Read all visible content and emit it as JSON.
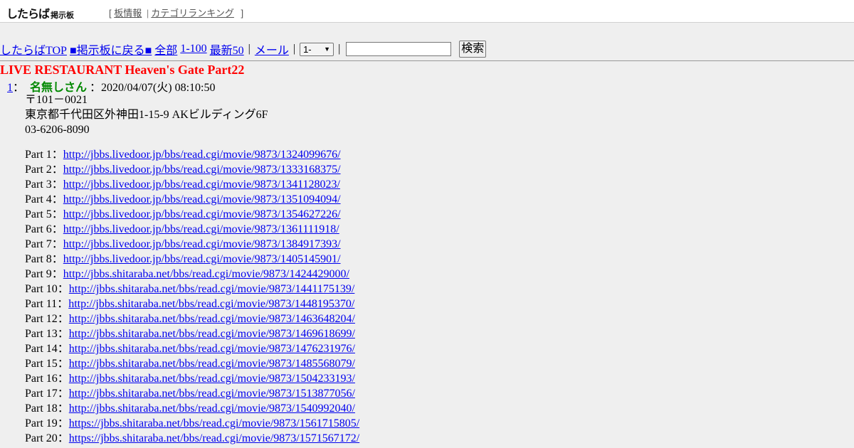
{
  "header": {
    "logo_main": "したらば",
    "logo_sub": "掲示板",
    "bracket_open": "[",
    "bracket_close": "]",
    "links": [
      "板情報",
      "カテゴリランキング"
    ]
  },
  "nav": {
    "top": "したらばTOP",
    "back": "■掲示板に戻る■",
    "all": "全部",
    "range": "1-100",
    "latest": "最新50",
    "mail": "メール",
    "select_value": "1-",
    "search_button": "検索",
    "search_value": ""
  },
  "thread_title": "LIVE RESTAURANT Heaven's Gate Part22",
  "post": {
    "number": "1",
    "colon": "：",
    "name": "名無しさん",
    "date": "：2020/04/07(火) 08:10:50",
    "address_lines": [
      "〒101－0021",
      "東京都千代田区外神田1-15-9 AKビルディング6F",
      "03-6206-8090"
    ],
    "parts": [
      {
        "label": "Part 1：",
        "url": "http://jbbs.livedoor.jp/bbs/read.cgi/movie/9873/1324099676/"
      },
      {
        "label": "Part 2：",
        "url": "http://jbbs.livedoor.jp/bbs/read.cgi/movie/9873/1333168375/"
      },
      {
        "label": "Part 3：",
        "url": "http://jbbs.livedoor.jp/bbs/read.cgi/movie/9873/1341128023/"
      },
      {
        "label": "Part 4：",
        "url": "http://jbbs.livedoor.jp/bbs/read.cgi/movie/9873/1351094094/"
      },
      {
        "label": "Part 5：",
        "url": "http://jbbs.livedoor.jp/bbs/read.cgi/movie/9873/1354627226/"
      },
      {
        "label": "Part 6：",
        "url": "http://jbbs.livedoor.jp/bbs/read.cgi/movie/9873/1361111918/"
      },
      {
        "label": "Part 7：",
        "url": "http://jbbs.livedoor.jp/bbs/read.cgi/movie/9873/1384917393/"
      },
      {
        "label": "Part 8：",
        "url": "http://jbbs.livedoor.jp/bbs/read.cgi/movie/9873/1405145901/"
      },
      {
        "label": "Part 9：",
        "url": "http://jbbs.shitaraba.net/bbs/read.cgi/movie/9873/1424429000/"
      },
      {
        "label": "Part 10：",
        "url": "http://jbbs.shitaraba.net/bbs/read.cgi/movie/9873/1441175139/"
      },
      {
        "label": "Part 11：",
        "url": "http://jbbs.shitaraba.net/bbs/read.cgi/movie/9873/1448195370/"
      },
      {
        "label": "Part 12：",
        "url": "http://jbbs.shitaraba.net/bbs/read.cgi/movie/9873/1463648204/"
      },
      {
        "label": "Part 13：",
        "url": "http://jbbs.shitaraba.net/bbs/read.cgi/movie/9873/1469618699/"
      },
      {
        "label": "Part 14：",
        "url": "http://jbbs.shitaraba.net/bbs/read.cgi/movie/9873/1476231976/"
      },
      {
        "label": "Part 15：",
        "url": "http://jbbs.shitaraba.net/bbs/read.cgi/movie/9873/1485568079/"
      },
      {
        "label": "Part 16：",
        "url": "http://jbbs.shitaraba.net/bbs/read.cgi/movie/9873/1504233193/"
      },
      {
        "label": "Part 17：",
        "url": "http://jbbs.shitaraba.net/bbs/read.cgi/movie/9873/1513877056/"
      },
      {
        "label": "Part 18：",
        "url": "http://jbbs.shitaraba.net/bbs/read.cgi/movie/9873/1540992040/"
      },
      {
        "label": "Part 19：",
        "url": "https://jbbs.shitaraba.net/bbs/read.cgi/movie/9873/1561715805/"
      },
      {
        "label": "Part 20：",
        "url": "https://jbbs.shitaraba.net/bbs/read.cgi/movie/9873/1571567172/"
      }
    ]
  },
  "colors": {
    "background": "#efefef",
    "title": "#ff0000",
    "poster_name": "#008800",
    "link": "#0000ee"
  }
}
